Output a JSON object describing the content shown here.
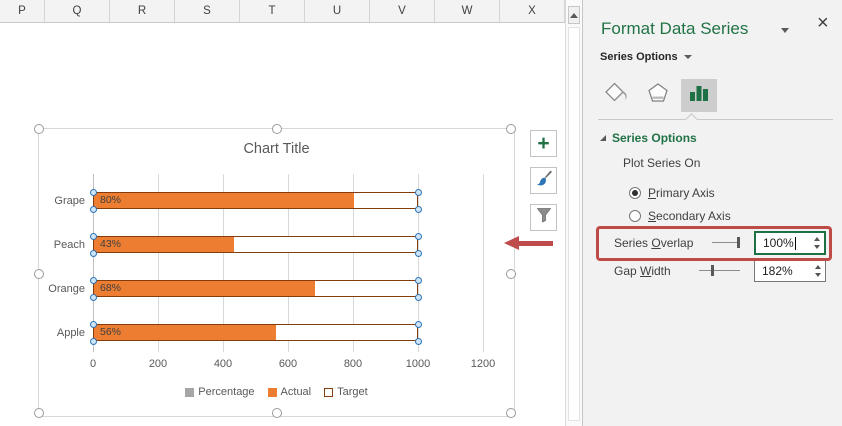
{
  "spreadsheet": {
    "column_headers": [
      "P",
      "Q",
      "R",
      "S",
      "T",
      "U",
      "V",
      "W",
      "X"
    ]
  },
  "chart": {
    "chart_data": {
      "type": "bar",
      "orientation": "horizontal",
      "title": "Chart Title",
      "categories": [
        "Grape",
        "Peach",
        "Orange",
        "Apple"
      ],
      "series": [
        {
          "name": "Percentage",
          "values": [
            0.8,
            0.43,
            0.68,
            0.56
          ],
          "labels": [
            "80%",
            "43%",
            "68%",
            "56%"
          ],
          "color": "#a6a6a6"
        },
        {
          "name": "Actual",
          "values": [
            800,
            430,
            680,
            560
          ],
          "color": "#ed7d31"
        },
        {
          "name": "Target",
          "values": [
            1000,
            1000,
            1000,
            1000
          ],
          "fill": "#ffffff",
          "border_color": "#843c0c"
        }
      ],
      "x_ticks": [
        "0",
        "200",
        "400",
        "600",
        "800",
        "1000",
        "1200"
      ],
      "xlim": [
        0,
        1200
      ],
      "gridlines": true,
      "legend_position": "bottom"
    },
    "tools": {
      "buttons": [
        {
          "name": "chart-elements",
          "icon": "plus-icon",
          "glyph": "+"
        },
        {
          "name": "chart-styles",
          "icon": "paintbrush-icon"
        },
        {
          "name": "chart-filters",
          "icon": "funnel-icon"
        }
      ]
    },
    "selection": {
      "handles": 8,
      "series_selected": "Target"
    }
  },
  "scrollbar": {
    "direction": "vertical",
    "up_arrow": "▲"
  },
  "panel": {
    "title": "Format Data Series",
    "close_icon": "×",
    "options_dropdown_label": "Series Options",
    "tabs": [
      {
        "name": "fill-line",
        "selected": false
      },
      {
        "name": "effects",
        "selected": false
      },
      {
        "name": "series-options",
        "selected": true
      }
    ],
    "section": {
      "title": "Series Options",
      "plot_series_on_label": "Plot Series On",
      "radios": [
        {
          "prefix": "",
          "accel": "P",
          "suffix": "rimary Axis",
          "selected": true
        },
        {
          "prefix": "",
          "accel": "S",
          "suffix": "econdary Axis",
          "selected": false
        }
      ],
      "series_overlap": {
        "prefix": "Series ",
        "accel": "O",
        "suffix": "verlap",
        "value": "100%"
      },
      "gap_width": {
        "prefix": "Gap ",
        "accel": "W",
        "suffix": "idth",
        "value": "182%"
      }
    }
  },
  "annotations": {
    "arrow_direction": "left",
    "highlight_target": "series-overlap-row"
  },
  "colors": {
    "excel_green": "#217346",
    "actual_orange": "#ed7d31",
    "target_border": "#843c0c",
    "percentage_gray": "#a6a6a6",
    "annotation_red": "#bf4b48",
    "handle_blue": "#2e75b6",
    "chart_text": "#595959"
  }
}
